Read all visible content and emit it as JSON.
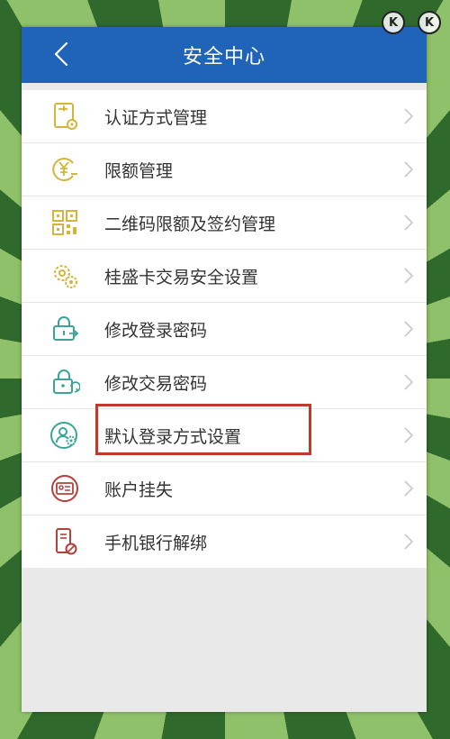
{
  "header": {
    "title": "安全中心",
    "back_icon": "back-arrow-icon"
  },
  "corner": {
    "icons": [
      "k-badge-icon",
      "k-badge-icon"
    ],
    "text": [
      "K",
      "K"
    ]
  },
  "menu": [
    {
      "label": "认证方式管理",
      "icon": "certificate-gear-icon"
    },
    {
      "label": "限额管理",
      "icon": "yuan-limit-icon"
    },
    {
      "label": "二维码限额及签约管理",
      "icon": "qr-code-icon"
    },
    {
      "label": "桂盛卡交易安全设置",
      "icon": "gears-icon"
    },
    {
      "label": "修改登录密码",
      "icon": "lock-login-icon"
    },
    {
      "label": "修改交易密码",
      "icon": "lock-refresh-icon"
    },
    {
      "label": "默认登录方式设置",
      "icon": "user-gear-icon"
    },
    {
      "label": "账户挂失",
      "icon": "id-card-icon"
    },
    {
      "label": "手机银行解绑",
      "icon": "phone-unbind-icon"
    }
  ],
  "colors": {
    "header_bg": "#1f64b8",
    "highlight_border": "#c0392b",
    "icon_yellow": "#d4b53a",
    "icon_green": "#3aa597",
    "icon_red": "#b4403a"
  }
}
